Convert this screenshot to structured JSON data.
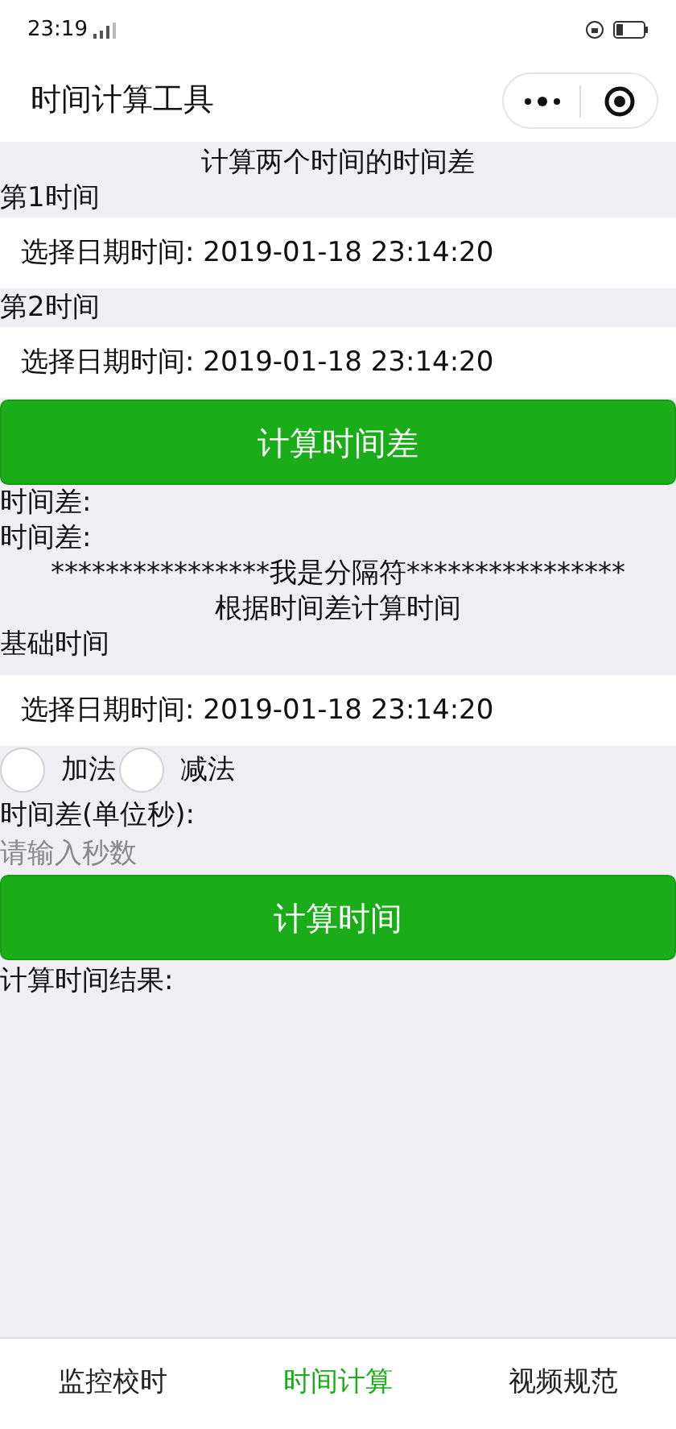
{
  "status_bar": {
    "time": "23:19"
  },
  "nav": {
    "title": "时间计算工具"
  },
  "section1": {
    "title": "计算两个时间的时间差",
    "fields": [
      {
        "label": "第1时间",
        "picker": "选择日期时间: 2019-01-18 23:14:20"
      },
      {
        "label": "第2时间",
        "picker": "选择日期时间: 2019-01-18 23:14:20"
      }
    ],
    "button": "计算时间差",
    "results": [
      "时间差:",
      "时间差:"
    ]
  },
  "separator": "****************我是分隔符****************",
  "section2": {
    "title": "根据时间差计算时间",
    "label": "基础时间",
    "picker": "选择日期时间: 2019-01-18 23:14:20",
    "radios": [
      {
        "label": "加法",
        "selected": false
      },
      {
        "label": "减法",
        "selected": false
      }
    ],
    "input_label": "时间差(单位秒):",
    "input": {
      "placeholder": "请输入秒数"
    },
    "button": "计算时间",
    "result": "计算时间结果:"
  },
  "tab_bar": [
    {
      "label": "监控校时",
      "selected": false
    },
    {
      "label": "时间计算",
      "selected": true
    },
    {
      "label": "视频规范",
      "selected": false
    }
  ]
}
